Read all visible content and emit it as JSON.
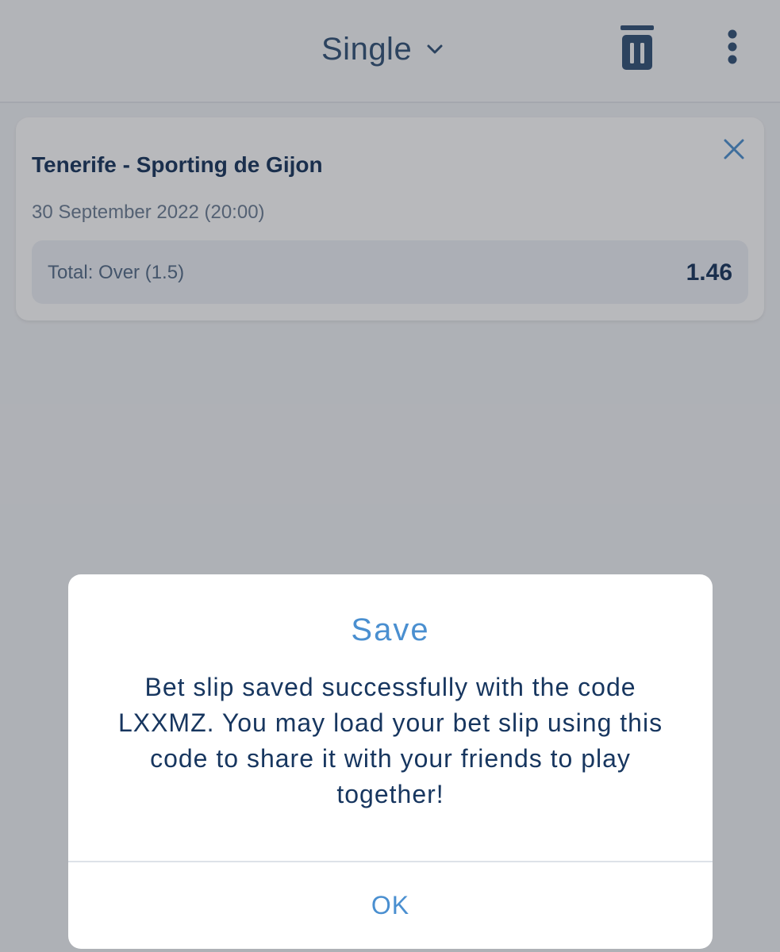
{
  "header": {
    "mode_label": "Single",
    "icons": {
      "mode_dropdown": "chevron-down-icon",
      "clear_all": "trash-icon",
      "more": "more-vertical-icon"
    }
  },
  "bet": {
    "match": "Tenerife - Sporting de Gijon",
    "date": "30 September 2022 (20:00)",
    "market": "Total: Over (1.5)",
    "odds": "1.46",
    "remove_icon": "close-icon"
  },
  "dialog": {
    "title": "Save",
    "message": "Bet slip saved successfully with the code LXXMZ. You may load your bet slip using this code to share it with your friends to play together!",
    "ok_label": "OK"
  },
  "colors": {
    "primary_dark": "#14325a",
    "accent_blue": "#4a8fd0",
    "header_icon": "#2f4f75",
    "overlay": "rgba(40,44,52,0.33)"
  }
}
